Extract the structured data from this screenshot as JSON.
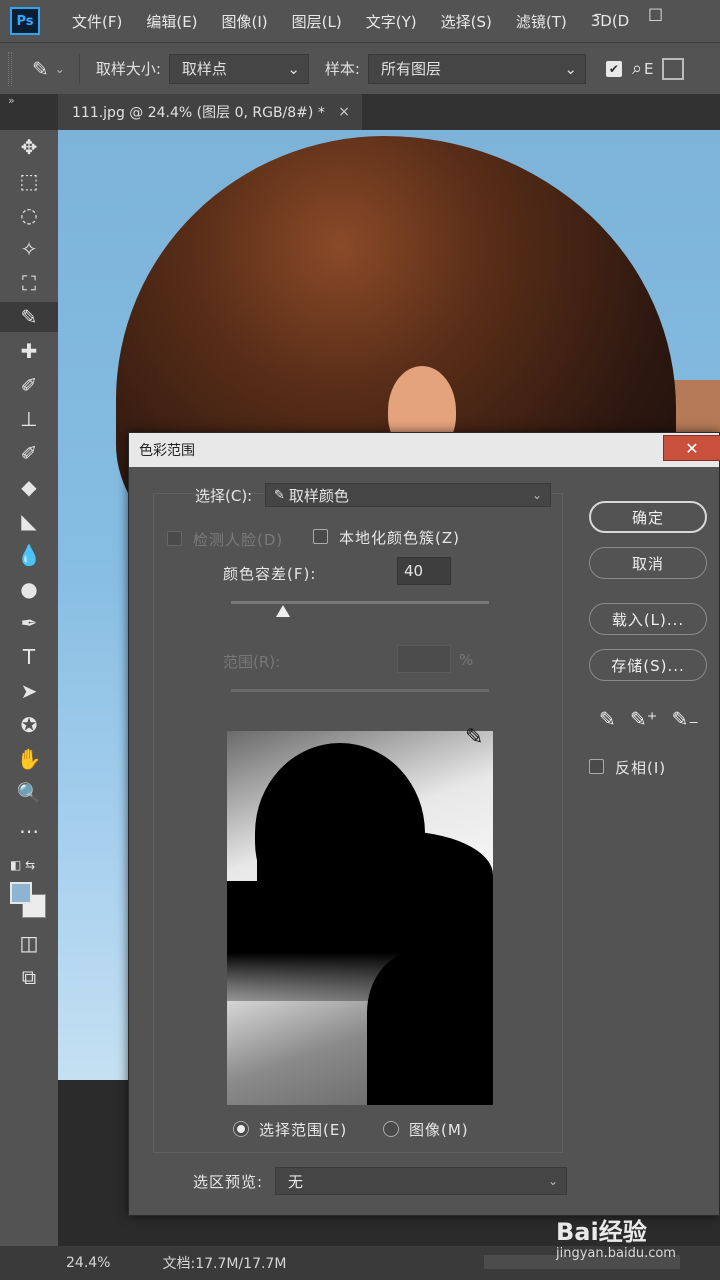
{
  "app": {
    "logo": "Ps"
  },
  "menu": [
    "文件(F)",
    "编辑(E)",
    "图像(I)",
    "图层(L)",
    "文字(Y)",
    "选择(S)",
    "滤镜(T)",
    "3D(D"
  ],
  "window_controls": {
    "minimize": "–",
    "restore": "□"
  },
  "options": {
    "sample_size_label": "取样大小:",
    "sample_size_value": "取样点",
    "sample_label": "样本:",
    "sample_value": "所有图层",
    "trail_text": "E"
  },
  "document_tab": {
    "title": "111.jpg @ 24.4% (图层 0, RGB/8#) *",
    "close": "×"
  },
  "toolbar": {
    "collapse": "»",
    "icons": [
      "move-icon",
      "marquee-icon",
      "lasso-icon",
      "magic-wand-icon",
      "crop-icon",
      "eyedropper-icon",
      "healing-brush-icon",
      "brush-icon",
      "stamp-icon",
      "history-brush-icon",
      "eraser-icon",
      "paint-bucket-icon",
      "blur-icon",
      "dodge-icon",
      "pen-icon",
      "type-icon",
      "path-selection-icon",
      "shape-icon",
      "hand-icon",
      "zoom-icon",
      "more-icon"
    ],
    "glyphs": [
      "✥",
      "⬚",
      "◌",
      "✧",
      "⛶",
      "✎",
      "✚",
      "✐",
      "⊥",
      "✐",
      "◆",
      "◣",
      "💧",
      "●",
      "✒",
      "T",
      "➤",
      "✪",
      "✋",
      "🔍",
      "⋯"
    ],
    "fg_color": "#8fb4d1",
    "bg_color": "#ececec"
  },
  "dialog": {
    "title": "色彩范围",
    "close": "✕",
    "select_label": "选择(C):",
    "select_value": "取样颜色",
    "detect_faces": "检测人脸(D)",
    "localized_clusters": "本地化颜色簇(Z)",
    "fuzziness_label": "颜色容差(F):",
    "fuzziness_value": "40",
    "fuzziness_slider": 0.2,
    "range_label": "范围(R):",
    "range_pct": "%",
    "radio_selection": "选择范围(E)",
    "radio_image": "图像(M)",
    "preview_label": "选区预览:",
    "preview_value": "无",
    "buttons": {
      "ok": "确定",
      "cancel": "取消",
      "load": "载入(L)...",
      "save": "存储(S)..."
    },
    "invert": "反相(I)"
  },
  "status": {
    "zoom": "24.4%",
    "doc": "文档:17.7M/17.7M"
  },
  "watermark": {
    "brand": "Bai经验",
    "url": "jingyan.baidu.com"
  }
}
